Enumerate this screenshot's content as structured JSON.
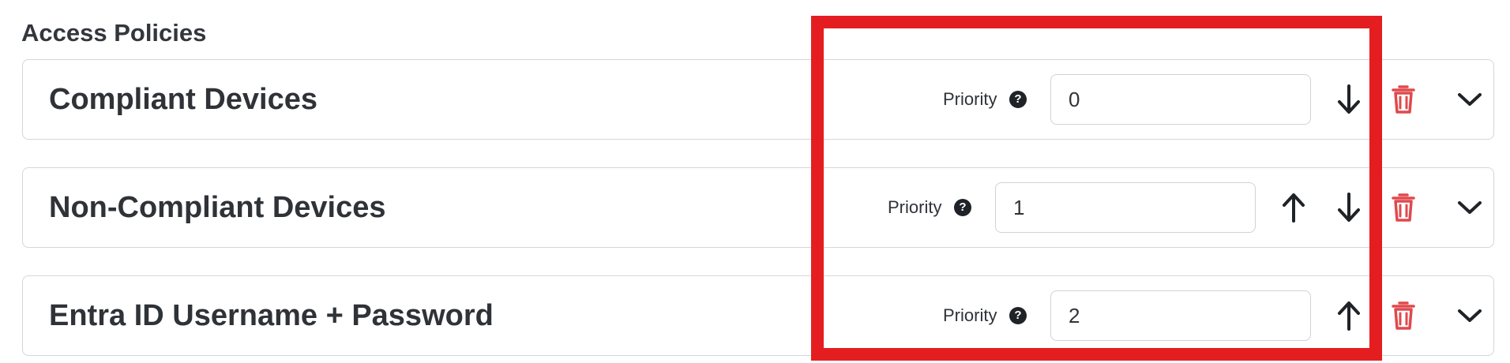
{
  "section": {
    "title": "Access Policies"
  },
  "policies": [
    {
      "name": "Compliant Devices",
      "priority_label": "Priority",
      "priority_value": "0",
      "move_up": false,
      "move_down": true
    },
    {
      "name": "Non-Compliant Devices",
      "priority_label": "Priority",
      "priority_value": "1",
      "move_up": true,
      "move_down": true
    },
    {
      "name": "Entra ID Username + Password",
      "priority_label": "Priority",
      "priority_value": "2",
      "move_up": true,
      "move_down": false
    }
  ],
  "icons": {
    "help": "help-icon",
    "move_up": "arrow-up-icon",
    "move_down": "arrow-down-icon",
    "delete": "trash-icon",
    "expand": "chevron-down-icon",
    "help_glyph": "?"
  },
  "colors": {
    "text": "#2f3338",
    "border": "#d3d6da",
    "delete": "#e0494c",
    "highlight": "#e41e20"
  }
}
